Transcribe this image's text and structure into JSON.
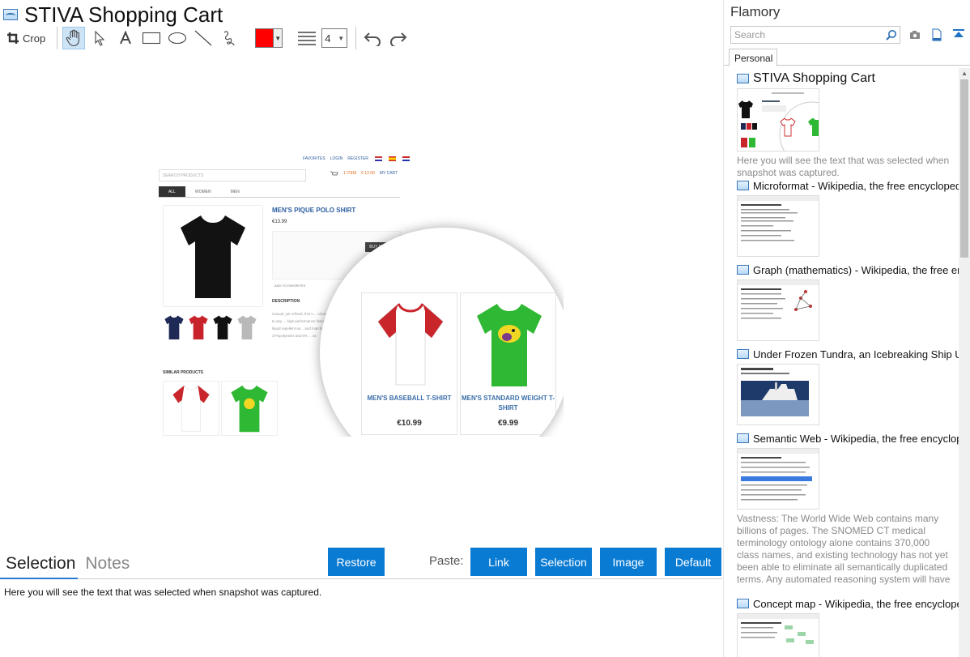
{
  "window": {
    "title": "STIVA Shopping Cart"
  },
  "toolbar": {
    "crop_label": "Crop",
    "color": "#ff0000",
    "line_width": "4"
  },
  "preview": {
    "top_links": [
      "FAVORITES",
      "LOGIN",
      "REGISTER"
    ],
    "search_placeholder": "SEARCH PRODUCTS",
    "cart_items": "1 ITEM",
    "cart_total": "€ 12.00",
    "my_cart": "MY CART",
    "tabs": [
      "ALL",
      "WOMEN",
      "MEN"
    ],
    "product_title": "MEN'S PIQUE POLO SHIRT",
    "product_price": "€13.99",
    "buy_now": "BUY NOW",
    "add_to_favorites": "ADD TO FAVORITES",
    "description_heading": "DESCRIPTION",
    "description_text": "Casual, yet refined, this s... colored addition to any ... high performance fabric ... both liquid repellent an... and matching buttons. ... 37%polyester and 5% ... as",
    "similar_heading": "SIMILAR PRODUCTS",
    "magnified": [
      {
        "name": "MEN'S BASEBALL T-SHIRT",
        "price": "€10.99"
      },
      {
        "name": "MEN'S STANDARD WEIGHT T-SHIRT",
        "price": "€9.99"
      }
    ]
  },
  "bottom": {
    "tabs": [
      "Selection",
      "Notes"
    ],
    "restore_label": "Restore",
    "paste_label": "Paste:",
    "paste_buttons": [
      "Link",
      "Selection",
      "Image",
      "Default"
    ],
    "selection_text": "Here you will see the text that was selected when snapshot was captured."
  },
  "sidebar": {
    "title": "Flamory",
    "search_placeholder": "Search",
    "tab": "Personal",
    "items": [
      {
        "title": "STIVA Shopping Cart",
        "desc": "Here you will see the text that was selected when snapshot was captured."
      },
      {
        "title": "Microformat - Wikipedia, the free encyclopedia"
      },
      {
        "title": "Graph (mathematics) - Wikipedia, the free encyclopedia"
      },
      {
        "title": "Under Frozen Tundra, an Icebreaking Ship Uncovers..."
      },
      {
        "title": "Semantic Web - Wikipedia, the free encyclopedia",
        "desc": "Vastness: The World Wide Web contains many billions of pages. The SNOMED CT medical terminology ontology alone contains 370,000 class names, and existing technology has not yet been able to eliminate all semantically duplicated terms. Any automated reasoning system will have to deal with truly huge inputs."
      },
      {
        "title": "Concept map - Wikipedia, the free encyclopedia"
      }
    ]
  },
  "colors": {
    "accent": "#0a7bd3",
    "tab_underline": "#2b7bd0",
    "link_blue": "#3b6ea8"
  }
}
